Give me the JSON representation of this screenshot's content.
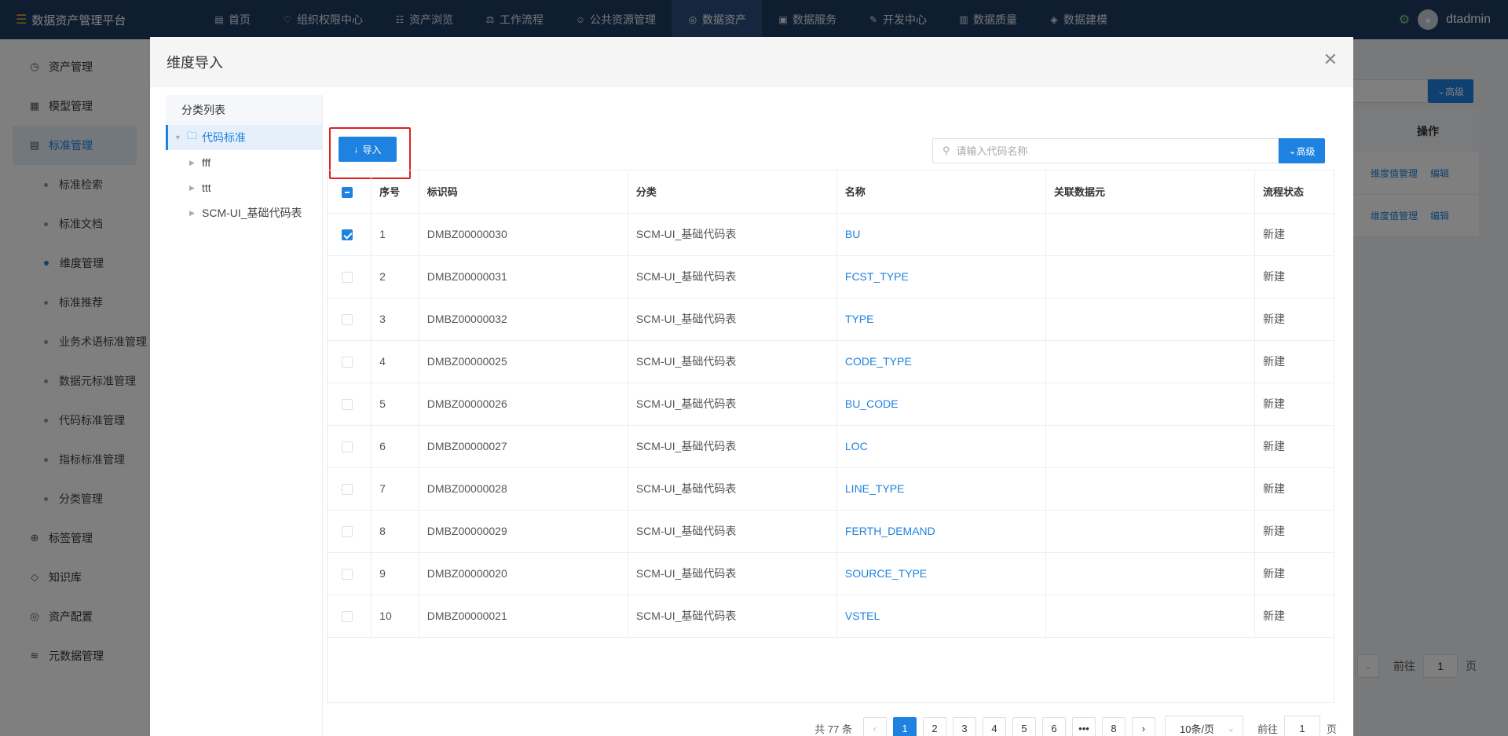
{
  "app": {
    "title": "数据资产管理平台"
  },
  "nav": [
    {
      "label": "首页",
      "icon": "home-icon"
    },
    {
      "label": "组织权限中心",
      "icon": "shield-icon"
    },
    {
      "label": "资产浏览",
      "icon": "grid-icon"
    },
    {
      "label": "工作流程",
      "icon": "flow-icon"
    },
    {
      "label": "公共资源管理",
      "icon": "people-icon"
    },
    {
      "label": "数据资产",
      "icon": "asset-icon",
      "active": true
    },
    {
      "label": "数据服务",
      "icon": "service-icon"
    },
    {
      "label": "开发中心",
      "icon": "edit-icon"
    },
    {
      "label": "数据质量",
      "icon": "quality-icon"
    },
    {
      "label": "数据建模",
      "icon": "layers-icon"
    }
  ],
  "user": {
    "name": "dtadmin"
  },
  "sidebar": {
    "items": [
      {
        "label": "资产管理"
      },
      {
        "label": "模型管理"
      },
      {
        "label": "标准管理"
      }
    ],
    "sub": [
      {
        "label": "标准检索"
      },
      {
        "label": "标准文档"
      },
      {
        "label": "维度管理"
      },
      {
        "label": "标准推荐"
      },
      {
        "label": "业务术语标准管理"
      },
      {
        "label": "数据元标准管理"
      },
      {
        "label": "代码标准管理"
      },
      {
        "label": "指标标准管理"
      },
      {
        "label": "分类管理"
      }
    ],
    "after": [
      {
        "label": "标签管理"
      },
      {
        "label": "知识库"
      },
      {
        "label": "资产配置"
      },
      {
        "label": "元数据管理"
      }
    ]
  },
  "background": {
    "advanced": "高级",
    "ops_header": "操作",
    "row_link1": "维度值管理",
    "row_link2": "编辑",
    "goto_label": "前往",
    "goto_value": "1",
    "page_unit": "页"
  },
  "dialog": {
    "title": "维度导入",
    "tree": {
      "title": "分类列表",
      "root": "代码标准",
      "children": [
        "fff",
        "ttt",
        "SCM-UI_基础代码表"
      ]
    },
    "import_label": "导入",
    "search": {
      "placeholder": "请输入代码名称",
      "value": ""
    },
    "advanced_label": "高级",
    "table": {
      "headers": [
        "序号",
        "标识码",
        "分类",
        "名称",
        "关联数据元",
        "流程状态"
      ],
      "rows": [
        {
          "no": "1",
          "code": "DMBZ00000030",
          "cat": "SCM-UI_基础代码表",
          "name": "BU",
          "rel": "",
          "status": "新建",
          "checked": true
        },
        {
          "no": "2",
          "code": "DMBZ00000031",
          "cat": "SCM-UI_基础代码表",
          "name": "FCST_TYPE",
          "rel": "",
          "status": "新建"
        },
        {
          "no": "3",
          "code": "DMBZ00000032",
          "cat": "SCM-UI_基础代码表",
          "name": "TYPE",
          "rel": "",
          "status": "新建"
        },
        {
          "no": "4",
          "code": "DMBZ00000025",
          "cat": "SCM-UI_基础代码表",
          "name": "CODE_TYPE",
          "rel": "",
          "status": "新建"
        },
        {
          "no": "5",
          "code": "DMBZ00000026",
          "cat": "SCM-UI_基础代码表",
          "name": "BU_CODE",
          "rel": "",
          "status": "新建"
        },
        {
          "no": "6",
          "code": "DMBZ00000027",
          "cat": "SCM-UI_基础代码表",
          "name": "LOC",
          "rel": "",
          "status": "新建"
        },
        {
          "no": "7",
          "code": "DMBZ00000028",
          "cat": "SCM-UI_基础代码表",
          "name": "LINE_TYPE",
          "rel": "",
          "status": "新建"
        },
        {
          "no": "8",
          "code": "DMBZ00000029",
          "cat": "SCM-UI_基础代码表",
          "name": "FERTH_DEMAND",
          "rel": "",
          "status": "新建"
        },
        {
          "no": "9",
          "code": "DMBZ00000020",
          "cat": "SCM-UI_基础代码表",
          "name": "SOURCE_TYPE",
          "rel": "",
          "status": "新建"
        },
        {
          "no": "10",
          "code": "DMBZ00000021",
          "cat": "SCM-UI_基础代码表",
          "name": "VSTEL",
          "rel": "",
          "status": "新建"
        }
      ]
    },
    "pager": {
      "total": "共 77 条",
      "pages": [
        "1",
        "2",
        "3",
        "4",
        "5",
        "6",
        "•••",
        "8"
      ],
      "current": "1",
      "size": "10条/页",
      "goto_label": "前往",
      "goto_value": "1",
      "unit": "页"
    }
  },
  "colors": {
    "primary": "#1e82e0",
    "nav_bg": "#1f3b63",
    "highlight": "#e02020"
  }
}
